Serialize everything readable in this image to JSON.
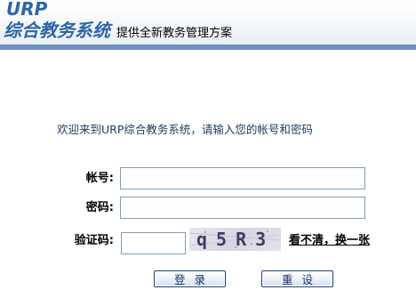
{
  "header": {
    "logo_urp": "URP",
    "logo_cn": "综合教务系统",
    "tagline": "提供全新教务管理方案"
  },
  "welcome": "欢迎来到URP综合教务系统，请输入您的帐号和密码",
  "form": {
    "account_label": "帐号:",
    "account_value": "",
    "password_label": "密码:",
    "password_value": "",
    "captcha_label": "验证码:",
    "captcha_value": "",
    "captcha_image_text": "q5R3",
    "refresh_link": "看不清，换一张",
    "login_button": "登录",
    "reset_button": "重设"
  },
  "colors": {
    "brand_blue": "#2b66a6",
    "header_bar": "#6f93c2",
    "welcome_text": "#1c3a5e"
  }
}
